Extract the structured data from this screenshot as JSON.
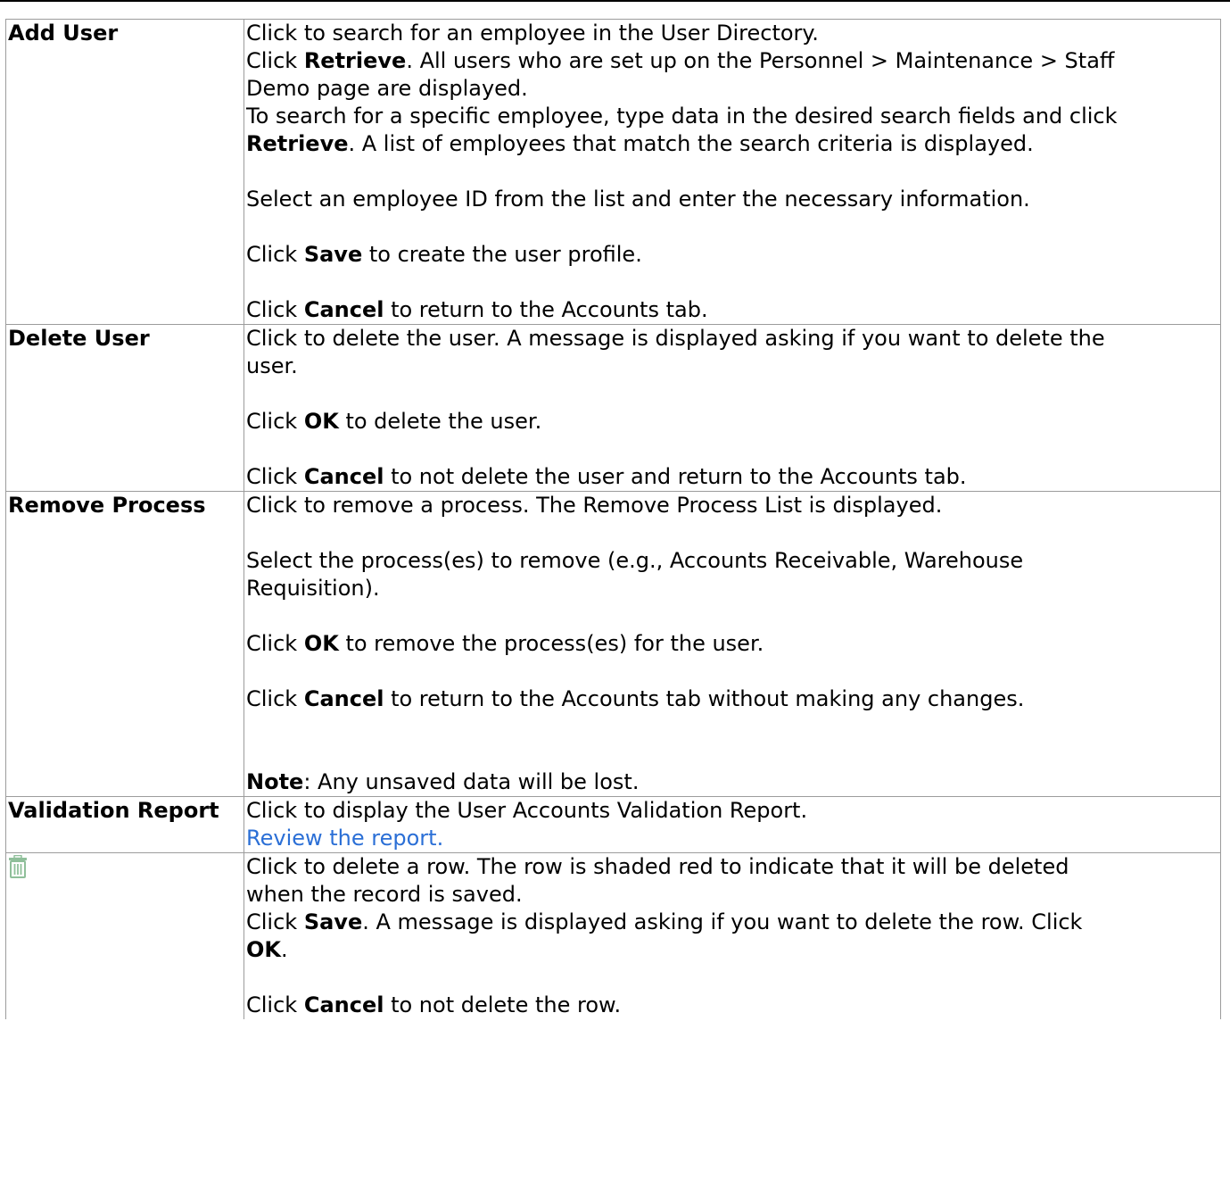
{
  "colors": {
    "border": "#9c9c9c",
    "link": "#2b6fd6",
    "trash_icon": "#8fbf9a"
  },
  "rows": [
    {
      "key": "Add User",
      "l1": "Click to search for an employee in the User Directory.",
      "l2_pre": "Click ",
      "l2_bold": "Retrieve",
      "l2_post": ". All users who are set up on the Personnel > Maintenance > Staff",
      "l3": "Demo page are displayed.",
      "l4": "To search for a specific employee, type data in the desired search fields and click",
      "l5_bold": "Retrieve",
      "l5_post": ". A list of employees that match the search criteria is displayed.",
      "l6": "Select an employee ID from the list and enter the necessary information.",
      "l7_pre": "Click ",
      "l7_bold": "Save",
      "l7_post": " to create the user profile.",
      "l8_pre": "Click ",
      "l8_bold": "Cancel",
      "l8_post": " to return to the Accounts tab."
    },
    {
      "key": "Delete User",
      "l1": "Click to delete the user. A message is displayed asking if you want to delete the",
      "l2": "user.",
      "l3_pre": "Click ",
      "l3_bold": "OK",
      "l3_post": " to delete the user.",
      "l4_pre": "Click ",
      "l4_bold": "Cancel",
      "l4_post": " to not delete the user and return to the Accounts tab."
    },
    {
      "key": "Remove Process",
      "l1": "Click to remove a process. The Remove Process List is displayed.",
      "l2": "Select the process(es) to remove (e.g., Accounts Receivable, Warehouse",
      "l3": "Requisition).",
      "l4_pre": "Click ",
      "l4_bold": "OK",
      "l4_post": " to remove the process(es) for the user.",
      "l5_pre": "Click ",
      "l5_bold": "Cancel",
      "l5_post": " to return to the Accounts tab without making any changes.",
      "l6_bold": "Note",
      "l6_post": ": Any unsaved data will be lost."
    },
    {
      "key": "Validation Report",
      "l1": "Click to display the User Accounts Validation Report.",
      "link": "Review the report."
    },
    {
      "icon": "trash-icon",
      "l1": "Click to delete a row. The row is shaded red to indicate that it will be deleted",
      "l2": "when the record is saved.",
      "l3_pre": "Click ",
      "l3_bold": "Save",
      "l3_post": ". A message is displayed asking if you want to delete the row. Click",
      "l4_bold": "OK",
      "l4_post": ".",
      "l5_pre": "Click ",
      "l5_bold": "Cancel",
      "l5_post": " to not delete the row."
    }
  ]
}
